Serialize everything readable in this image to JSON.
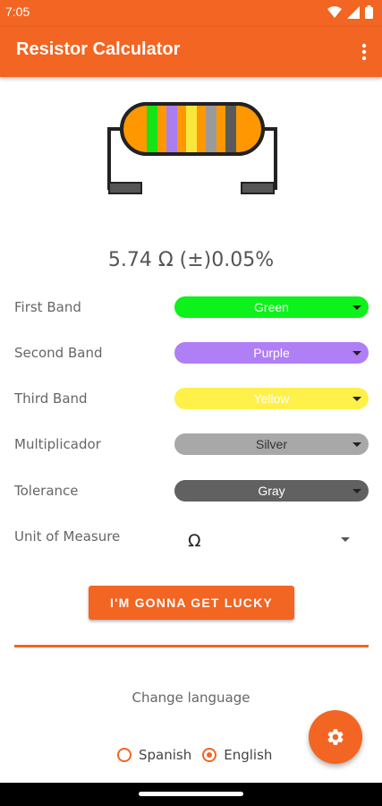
{
  "status_bar": {
    "time": "7:05",
    "icons": [
      "wifi-icon",
      "signal-icon",
      "battery-icon"
    ]
  },
  "app_bar": {
    "title": "Resistor Calculator",
    "menu_icon": "more-vert-icon"
  },
  "resistor": {
    "band_colors": [
      "#16e216",
      "#a97ef0",
      "#f9e63c",
      "#9a9a9a",
      "#5a5a5a"
    ],
    "body_color": "#ff9800"
  },
  "result": {
    "text": "5.74 Ω (±)0.05%"
  },
  "bands": [
    {
      "label": "First Band",
      "value": "Green",
      "bg": "#0cf21a",
      "fg": "#ffffff"
    },
    {
      "label": "Second Band",
      "value": "Purple",
      "bg": "#b07ef5",
      "fg": "#ffffff"
    },
    {
      "label": "Third Band",
      "value": "Yellow",
      "bg": "#fff04a",
      "fg": "#ffffff"
    },
    {
      "label": "Multiplicador",
      "value": "Silver",
      "bg": "#a8a8a8",
      "fg": "#333333"
    },
    {
      "label": "Tolerance",
      "value": "Gray",
      "bg": "#616161",
      "fg": "#ffffff"
    }
  ],
  "unit": {
    "label": "Unit of Measure",
    "value": "Ω"
  },
  "lucky_button": {
    "label": "I'M GONNA GET LUCKY"
  },
  "language": {
    "title": "Change language",
    "options": [
      {
        "label": "Spanish",
        "checked": false
      },
      {
        "label": "English",
        "checked": true
      }
    ]
  },
  "fab": {
    "icon": "settings-gear-icon"
  },
  "colors": {
    "accent": "#f26522"
  }
}
